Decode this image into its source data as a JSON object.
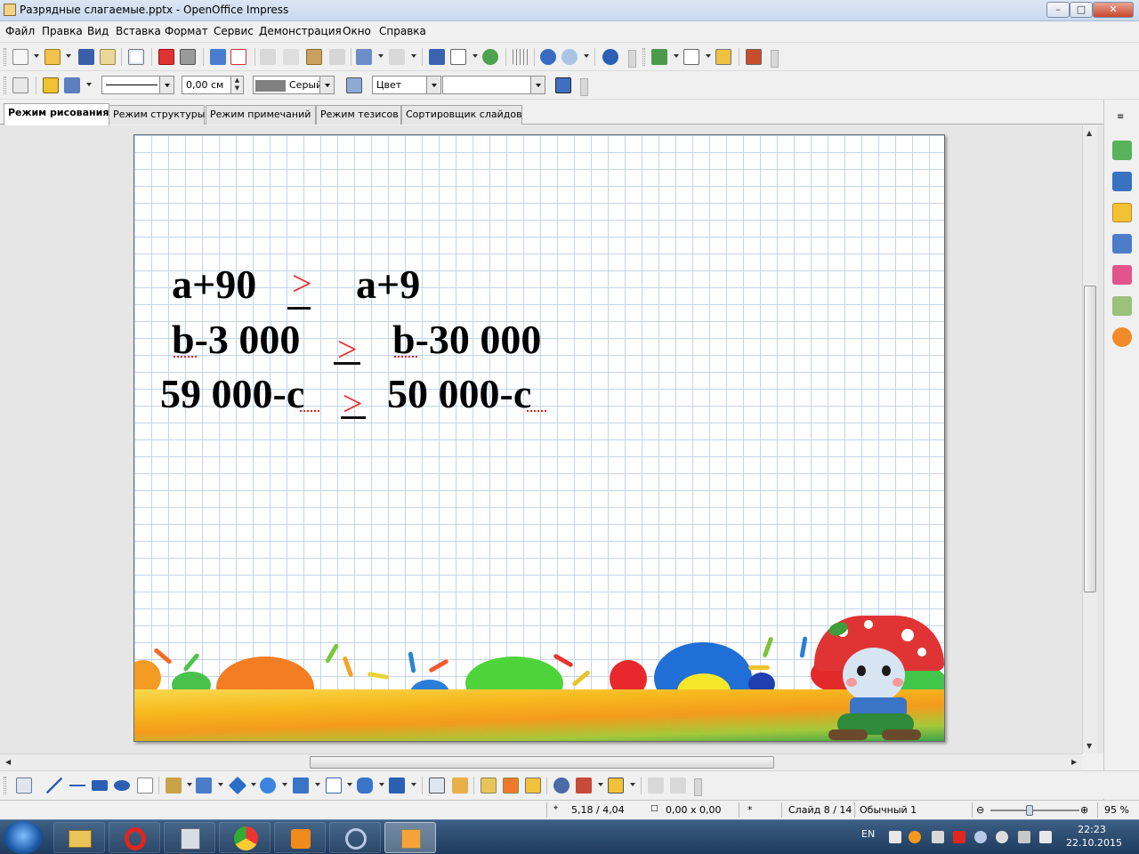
{
  "window": {
    "title": "Разрядные слагаемые.pptx - OpenOffice Impress"
  },
  "menu": [
    "Файл",
    "Правка",
    "Вид",
    "Вставка",
    "Формат",
    "Сервис",
    "Демонстрация",
    "Окно",
    "Справка"
  ],
  "line_props": {
    "width_value": "0,00 см",
    "color_name": "Серый",
    "area_style": "Цвет",
    "area_fill": ""
  },
  "tabs": [
    "Режим рисования",
    "Режим структуры",
    "Режим примечаний",
    "Режим тезисов",
    "Сортировщик слайдов"
  ],
  "slide": {
    "rows": [
      {
        "left": "a+90",
        "sign": ">",
        "right": "a+9"
      },
      {
        "left": "b-3 000",
        "sign": ">",
        "right": "b-30 000"
      },
      {
        "left": "59 000-c",
        "sign": ">",
        "right": "50 000-c"
      }
    ]
  },
  "status": {
    "position": "5,18 / 4,04",
    "size": "0,00 x 0,00",
    "modified": "*",
    "slide": "Слайд 8 / 14",
    "layout": "Обычный 1",
    "zoom": "95 %",
    "zoom_level_percent": 95
  },
  "taskbar": {
    "language": "EN",
    "time": "22:23",
    "date": "22.10.2015"
  },
  "colors": {
    "comparison_sign": "#e8322b",
    "grid": "#c5d4ea",
    "titlebar": "#c9d9ee"
  },
  "icons": {
    "toolbar": [
      "new-icon",
      "open-icon",
      "save-icon",
      "email-icon",
      "edit-file-icon",
      "export-pdf-icon",
      "print-icon",
      "spellcheck-icon",
      "autospell-icon",
      "cut-icon",
      "copy-icon",
      "paste-icon",
      "clone-format-icon",
      "undo-icon",
      "redo-icon",
      "chart-icon",
      "table-icon",
      "display-grid-icon",
      "navigator-icon",
      "zoom-icon",
      "help-icon"
    ],
    "sidebar": [
      "properties-icon",
      "master-pages-icon",
      "custom-animation-icon",
      "slide-transition-icon",
      "gallery-icon",
      "styles-icon",
      "navigator-icon"
    ]
  }
}
